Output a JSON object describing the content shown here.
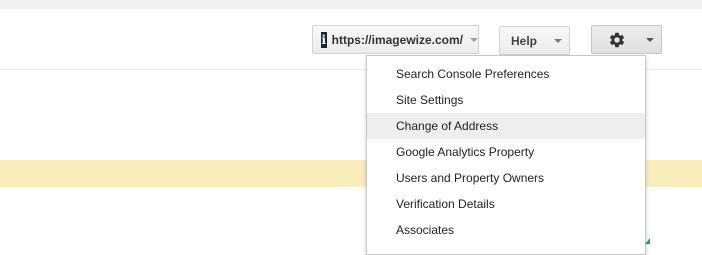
{
  "toolbar": {
    "site_selector": {
      "label": "https://imagewize.com/",
      "favicon_glyph": "i",
      "icon": "site-favicon-icon"
    },
    "help": {
      "label": "Help",
      "icon": "chevron-down-icon"
    },
    "settings": {
      "icon": "gear-icon",
      "caret_icon": "chevron-down-icon"
    }
  },
  "settings_menu": {
    "highlighted_index": 2,
    "items": [
      {
        "label": "Search Console Preferences"
      },
      {
        "label": "Site Settings"
      },
      {
        "label": "Change of Address"
      },
      {
        "label": "Google Analytics Property"
      },
      {
        "label": "Users and Property Owners"
      },
      {
        "label": "Verification Details"
      },
      {
        "label": "Associates"
      }
    ]
  },
  "colors": {
    "notice_band": "#f9edbe",
    "highlight": "#eeeeee",
    "top_strip": "#f1f1f1"
  }
}
